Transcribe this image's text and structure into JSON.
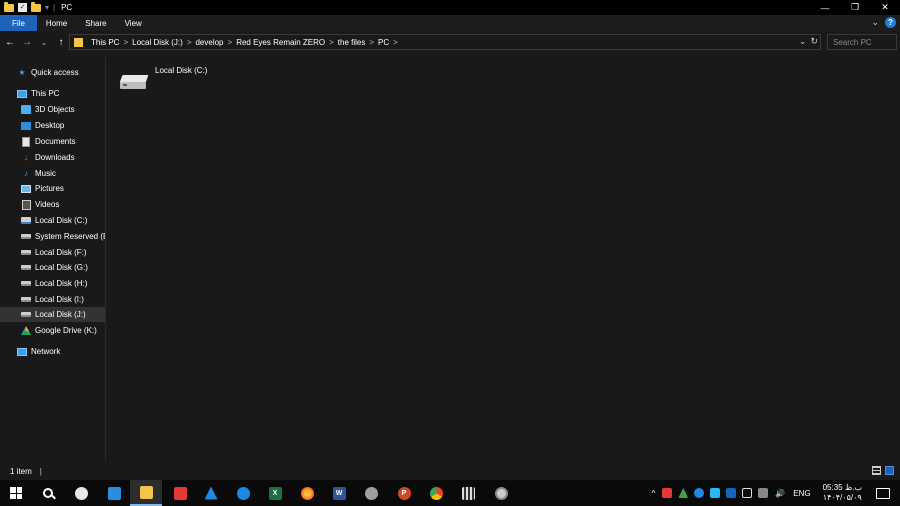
{
  "window": {
    "title": "PC",
    "qa_dropdown": "▾",
    "separator": "|",
    "minimize": "—",
    "restore": "❐",
    "close": "✕"
  },
  "ribbon": {
    "tabs": [
      "File",
      "Home",
      "Share",
      "View"
    ],
    "collapse": "⌄",
    "help": "?"
  },
  "nav": {
    "back": "←",
    "forward": "→",
    "recent": "⌄",
    "up": "↑"
  },
  "address": {
    "crumbs": [
      "This PC",
      "Local Disk (J:)",
      "develop",
      "Red Eyes Remain ZERO",
      "the files",
      "PC"
    ],
    "separator": ">",
    "dropdown": "⌄",
    "refresh": "↻"
  },
  "search": {
    "placeholder": "Search PC"
  },
  "sidebar": {
    "quick_access": "Quick access",
    "this_pc": "This PC",
    "items": [
      {
        "label": "3D Objects",
        "icon": "3d-objects-icon"
      },
      {
        "label": "Desktop",
        "icon": "desktop-icon"
      },
      {
        "label": "Documents",
        "icon": "documents-icon"
      },
      {
        "label": "Downloads",
        "icon": "downloads-icon"
      },
      {
        "label": "Music",
        "icon": "music-icon"
      },
      {
        "label": "Pictures",
        "icon": "pictures-icon"
      },
      {
        "label": "Videos",
        "icon": "videos-icon"
      },
      {
        "label": "Local Disk (C:)",
        "icon": "drive-c-icon"
      },
      {
        "label": "System Reserved (E:)",
        "icon": "drive-icon"
      },
      {
        "label": "Local Disk (F:)",
        "icon": "drive-icon"
      },
      {
        "label": "Local Disk (G:)",
        "icon": "drive-icon"
      },
      {
        "label": "Local Disk (H:)",
        "icon": "drive-icon"
      },
      {
        "label": "Local Disk (I:)",
        "icon": "drive-icon"
      },
      {
        "label": "Local Disk (J:)",
        "icon": "drive-icon",
        "selected": true
      },
      {
        "label": "Google Drive (K:)",
        "icon": "google-drive-icon"
      }
    ],
    "network": "Network"
  },
  "content": {
    "items": [
      {
        "label": "Local Disk (C:)",
        "icon": "hard-drive-icon"
      }
    ]
  },
  "status": {
    "item_count": "1 item",
    "caret": "|"
  },
  "taskbar": {
    "apps": [
      {
        "name": "windows-start",
        "icon": "windows-logo-icon"
      },
      {
        "name": "search",
        "icon": "search-icon"
      },
      {
        "name": "app-1",
        "icon": "app-icon"
      },
      {
        "name": "app-2",
        "icon": "app-icon"
      },
      {
        "name": "file-explorer",
        "icon": "folder-icon",
        "active": true
      },
      {
        "name": "anydesk",
        "icon": "app-icon"
      },
      {
        "name": "app-3",
        "icon": "app-icon"
      },
      {
        "name": "app-4",
        "icon": "app-icon"
      },
      {
        "name": "excel",
        "icon": "excel-icon",
        "glyph": "X"
      },
      {
        "name": "firefox",
        "icon": "firefox-icon"
      },
      {
        "name": "word",
        "icon": "word-icon",
        "glyph": "W"
      },
      {
        "name": "app-5",
        "icon": "app-icon"
      },
      {
        "name": "powerpoint",
        "icon": "powerpoint-icon",
        "glyph": "P"
      },
      {
        "name": "chrome",
        "icon": "chrome-icon"
      },
      {
        "name": "calculator",
        "icon": "calculator-icon"
      },
      {
        "name": "app-6",
        "icon": "app-icon"
      }
    ],
    "tray": {
      "chevron": "^",
      "volume": "🔊",
      "language": "ENG",
      "time": "05:35 ب.ظ",
      "date": "۱۴۰۴/۰۵/۰۹"
    }
  },
  "colors": {
    "accent": "#1f63b8",
    "background": "#191919",
    "folder": "#f2c54b"
  }
}
